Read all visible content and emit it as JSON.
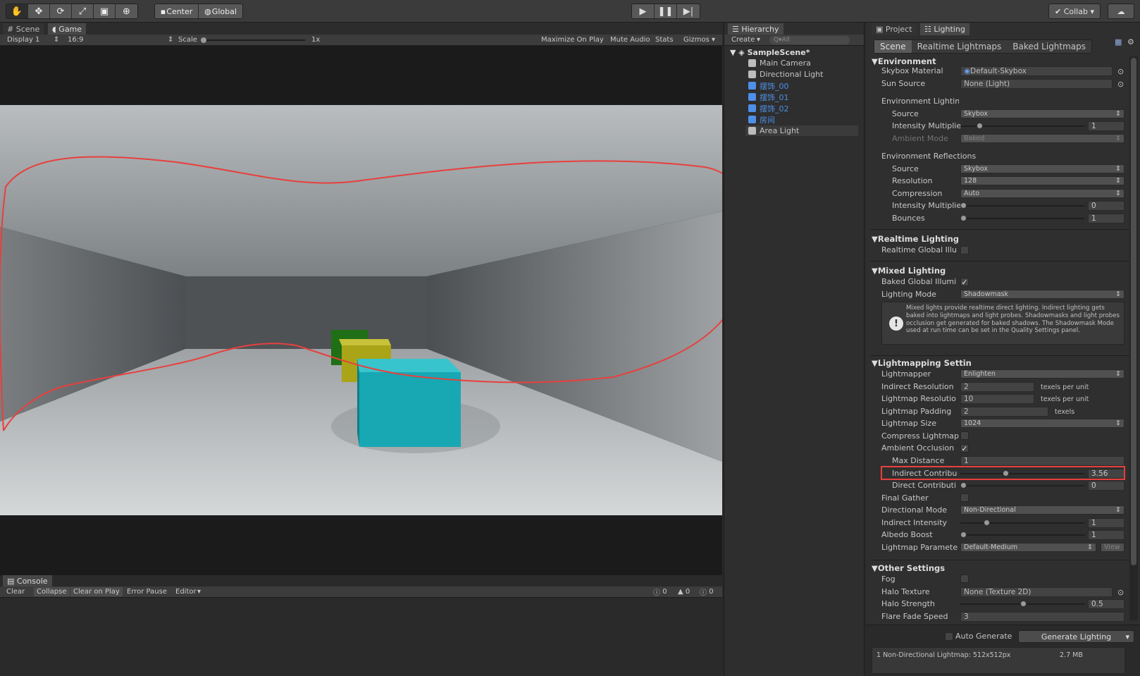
{
  "toolbar": {
    "tool_icons": [
      "hand-icon",
      "move-icon",
      "rotate-icon",
      "scale-icon",
      "rect-icon",
      "transform-icon"
    ],
    "pivot_label": "Center",
    "space_label": "Global",
    "collab_label": "Collab ▾"
  },
  "game_panel": {
    "scene_tab": "Scene",
    "game_tab": "Game",
    "display": "Display 1",
    "aspect": "16:9",
    "scale_label": "Scale",
    "scale_value": "1x",
    "maximize": "Maximize On Play",
    "mute": "Mute Audio",
    "stats": "Stats",
    "gizmos": "Gizmos"
  },
  "console": {
    "tab": "Console",
    "clear": "Clear",
    "collapse": "Collapse",
    "clear_on_play": "Clear on Play",
    "error_pause": "Error Pause",
    "editor": "Editor",
    "count_info": "0",
    "count_warn": "0",
    "count_err": "0"
  },
  "hierarchy": {
    "tab": "Hierarchy",
    "create": "Create",
    "search_placeholder": "Q▾All",
    "scene": "SampleScene*",
    "items": [
      {
        "label": "Main Camera",
        "blue": false
      },
      {
        "label": "Directional Light",
        "blue": false
      },
      {
        "label": "摆饰_00",
        "blue": true
      },
      {
        "label": "摆饰_01",
        "blue": true
      },
      {
        "label": "摆饰_02",
        "blue": true
      },
      {
        "label": "房间",
        "blue": true
      },
      {
        "label": "Area Light",
        "blue": false
      }
    ]
  },
  "lighting": {
    "project_tab": "Project",
    "lighting_tab": "Lighting",
    "subtabs": [
      "Scene",
      "Realtime Lightmaps",
      "Baked Lightmaps"
    ],
    "environment": "Environment",
    "skybox_material": "Skybox Material",
    "skybox_value": "Default-Skybox",
    "sun_source": "Sun Source",
    "sun_value": "None (Light)",
    "env_lighting": "Environment Lighting",
    "source": "Source",
    "source_value": "Skybox",
    "intensity_mult": "Intensity Multiplie",
    "intensity_mult_value": "1",
    "ambient_mode": "Ambient Mode",
    "ambient_value": "Baked",
    "env_reflections": "Environment Reflections",
    "refl_source": "Source",
    "refl_source_value": "Skybox",
    "resolution": "Resolution",
    "resolution_value": "128",
    "compression": "Compression",
    "compression_value": "Auto",
    "refl_intensity": "Intensity Multiplie",
    "refl_intensity_value": "0",
    "bounces": "Bounces",
    "bounces_value": "1",
    "realtime_lighting": "Realtime Lighting",
    "realtime_gi": "Realtime Global Illu",
    "mixed_lighting": "Mixed Lighting",
    "baked_gi": "Baked Global Illumi",
    "lighting_mode": "Lighting Mode",
    "lighting_mode_value": "Shadowmask",
    "info_text": "Mixed lights provide realtime direct lighting. Indirect lighting gets baked into lightmaps and light probes. Shadowmasks and light probes occlusion get generated for baked shadows. The Shadowmask Mode used at run time can be set in the Quality Settings panel.",
    "lightmapping_settings": "Lightmapping Settin",
    "lightmapper": "Lightmapper",
    "lightmapper_value": "Enlighten",
    "indirect_resolution": "Indirect Resolution",
    "indirect_resolution_value": "2",
    "lightmap_resolution": "Lightmap Resolutio",
    "lightmap_resolution_value": "10",
    "texels_per_unit": "texels per unit",
    "lightmap_padding": "Lightmap Padding",
    "lightmap_padding_value": "2",
    "texels": "texels",
    "lightmap_size": "Lightmap Size",
    "lightmap_size_value": "1024",
    "compress_lightmaps": "Compress Lightmap",
    "ambient_occlusion": "Ambient Occlusion",
    "max_distance": "Max Distance",
    "max_distance_value": "1",
    "indirect_contrib": "Indirect Contribu",
    "indirect_contrib_value": "3.56",
    "direct_contrib": "Direct Contributi",
    "direct_contrib_value": "0",
    "final_gather": "Final Gather",
    "directional_mode": "Directional Mode",
    "directional_mode_value": "Non-Directional",
    "indirect_intensity": "Indirect Intensity",
    "indirect_intensity_value": "1",
    "albedo_boost": "Albedo Boost",
    "albedo_boost_value": "1",
    "lightmap_params": "Lightmap Paramete",
    "lightmap_params_value": "Default-Medium",
    "view": "View",
    "other_settings": "Other Settings",
    "fog": "Fog",
    "halo_texture": "Halo Texture",
    "halo_texture_value": "None (Texture 2D)",
    "halo_strength": "Halo Strength",
    "halo_strength_value": "0.5",
    "flare_fade": "Flare Fade Speed",
    "flare_fade_value": "3",
    "auto_generate": "Auto Generate",
    "generate": "Generate Lighting",
    "footer_info": "1 Non-Directional Lightmap: 512x512px",
    "footer_size": "2.7 MB"
  },
  "colors": {
    "annotation_red": "#e8403d",
    "cube_cyan": "#17a8b4",
    "cube_yellow": "#a9a418",
    "cube_green": "#1f6f16"
  }
}
